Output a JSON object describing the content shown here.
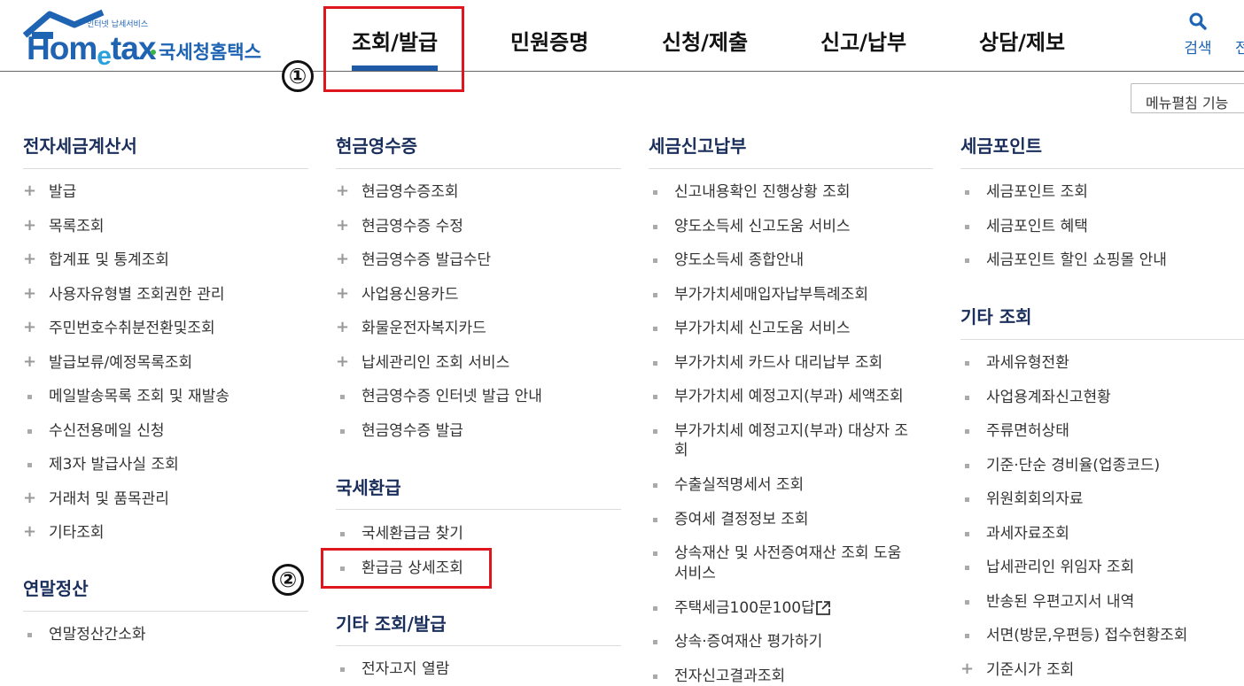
{
  "header": {
    "logo_small": "인터넷 납세서비스",
    "logo_home": "Hom",
    "logo_e": "e",
    "logo_tax": "tax",
    "logo_ko": "국세청홈택스",
    "nav": [
      "조회/발급",
      "민원증명",
      "신청/제출",
      "신고/납부",
      "상담/제보"
    ],
    "search_label": "검색",
    "cut_label": "전"
  },
  "menu_edit_label": "메뉴펼침 기능",
  "annotations": [
    "①",
    "②"
  ],
  "sections": {
    "tax_invoice": {
      "title": "전자세금계산서",
      "items": [
        {
          "label": "발급",
          "marker": "plus"
        },
        {
          "label": "목록조회",
          "marker": "plus"
        },
        {
          "label": "합계표 및 통계조회",
          "marker": "plus"
        },
        {
          "label": "사용자유형별 조회권한 관리",
          "marker": "plus"
        },
        {
          "label": "주민번호수취분전환및조회",
          "marker": "plus"
        },
        {
          "label": "발급보류/예정목록조회",
          "marker": "plus"
        },
        {
          "label": "메일발송목록 조회 및 재발송",
          "marker": "square"
        },
        {
          "label": "수신전용메일 신청",
          "marker": "square"
        },
        {
          "label": "제3자 발급사실 조회",
          "marker": "square"
        },
        {
          "label": "거래처 및 품목관리",
          "marker": "plus"
        },
        {
          "label": "기타조회",
          "marker": "plus"
        }
      ]
    },
    "year_end": {
      "title": "연말정산",
      "items": [
        {
          "label": "연말정산간소화",
          "marker": "square"
        }
      ]
    },
    "cash_receipt": {
      "title": "현금영수증",
      "items": [
        {
          "label": "현금영수증조회",
          "marker": "plus"
        },
        {
          "label": "현금영수증 수정",
          "marker": "plus"
        },
        {
          "label": "현금영수증 발급수단",
          "marker": "plus"
        },
        {
          "label": "사업용신용카드",
          "marker": "plus"
        },
        {
          "label": "화물운전자복지카드",
          "marker": "plus"
        },
        {
          "label": "납세관리인 조회 서비스",
          "marker": "plus"
        },
        {
          "label": "현금영수증 인터넷 발급 안내",
          "marker": "square"
        },
        {
          "label": "현금영수증 발급",
          "marker": "square"
        }
      ]
    },
    "refund": {
      "title": "국세환급",
      "items": [
        {
          "label": "국세환급금 찾기",
          "marker": "square"
        },
        {
          "label": "환급금 상세조회",
          "marker": "square"
        }
      ]
    },
    "other_issue": {
      "title": "기타 조회/발급",
      "items": [
        {
          "label": "전자고지 열람",
          "marker": "square"
        }
      ]
    },
    "tax_report": {
      "title": "세금신고납부",
      "items": [
        {
          "label": "신고내용확인 진행상황 조회",
          "marker": "square"
        },
        {
          "label": "양도소득세 신고도움 서비스",
          "marker": "square"
        },
        {
          "label": "양도소득세 종합안내",
          "marker": "square"
        },
        {
          "label": "부가가치세매입자납부특례조회",
          "marker": "square"
        },
        {
          "label": "부가가치세 신고도움 서비스",
          "marker": "square"
        },
        {
          "label": "부가가치세 카드사 대리납부 조회",
          "marker": "square"
        },
        {
          "label": "부가가치세 예정고지(부과) 세액조회",
          "marker": "square"
        },
        {
          "label": "부가가치세 예정고지(부과) 대상자 조",
          "label2": "회",
          "marker": "square"
        },
        {
          "label": "수출실적명세서 조회",
          "marker": "square"
        },
        {
          "label": "증여세 결정정보 조회",
          "marker": "square"
        },
        {
          "label": "상속재산 및 사전증여재산 조회 도움",
          "label2": "서비스",
          "marker": "square"
        },
        {
          "label": "주택세금100문100답",
          "marker": "square",
          "external": true
        },
        {
          "label": "상속·증여재산 평가하기",
          "marker": "square"
        },
        {
          "label": "전자신고결과조회",
          "marker": "square"
        }
      ]
    },
    "tax_point": {
      "title": "세금포인트",
      "items": [
        {
          "label": "세금포인트 조회",
          "marker": "square"
        },
        {
          "label": "세금포인트 혜택",
          "marker": "square"
        },
        {
          "label": "세금포인트 할인 쇼핑몰 안내",
          "marker": "square"
        }
      ]
    },
    "other_lookup": {
      "title": "기타 조회",
      "items": [
        {
          "label": "과세유형전환",
          "marker": "square"
        },
        {
          "label": "사업용계좌신고현황",
          "marker": "square"
        },
        {
          "label": "주류면허상태",
          "marker": "square"
        },
        {
          "label": "기준·단순 경비율(업종코드)",
          "marker": "square"
        },
        {
          "label": "위원회회의자료",
          "marker": "square"
        },
        {
          "label": "과세자료조회",
          "marker": "square"
        },
        {
          "label": "납세관리인 위임자 조회",
          "marker": "square"
        },
        {
          "label": "반송된 우편고지서 내역",
          "marker": "square"
        },
        {
          "label": "서면(방문,우편등) 접수현황조회",
          "marker": "square"
        },
        {
          "label": "기준시가 조회",
          "marker": "plus"
        }
      ]
    }
  }
}
